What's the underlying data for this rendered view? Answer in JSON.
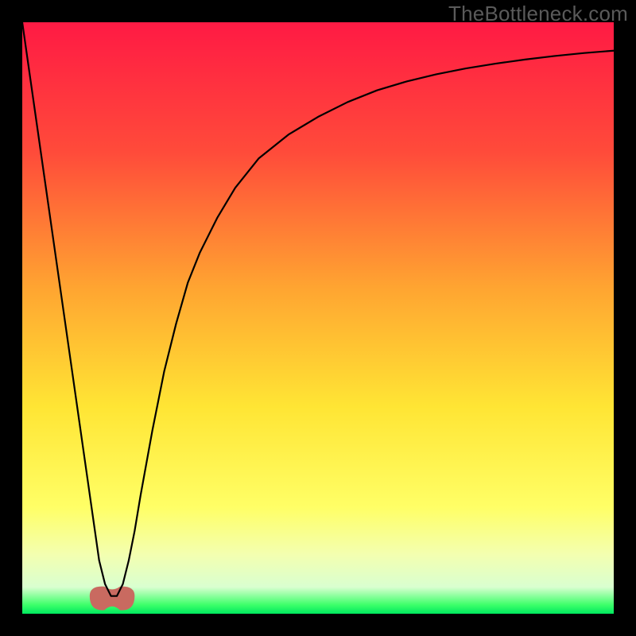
{
  "watermark": "TheBottleneck.com",
  "chart_data": {
    "type": "line",
    "title": "",
    "xlabel": "",
    "ylabel": "",
    "xlim": [
      0,
      100
    ],
    "ylim": [
      0,
      100
    ],
    "grid": false,
    "background_gradient": {
      "stops": [
        {
          "offset": 0.0,
          "color": "#ff1a44"
        },
        {
          "offset": 0.22,
          "color": "#ff4b3a"
        },
        {
          "offset": 0.45,
          "color": "#ffa531"
        },
        {
          "offset": 0.65,
          "color": "#ffe534"
        },
        {
          "offset": 0.82,
          "color": "#ffff66"
        },
        {
          "offset": 0.9,
          "color": "#f3ffb0"
        },
        {
          "offset": 0.955,
          "color": "#d9ffd0"
        },
        {
          "offset": 0.985,
          "color": "#3dff6a"
        },
        {
          "offset": 1.0,
          "color": "#00e85f"
        }
      ]
    },
    "series": [
      {
        "name": "bottleneck-v-curve",
        "color": "#000000",
        "width": 2.2,
        "x": [
          0,
          2,
          4,
          6,
          8,
          10,
          11,
          12,
          13,
          14,
          15,
          16,
          17,
          18,
          19,
          20,
          22,
          24,
          26,
          28,
          30,
          33,
          36,
          40,
          45,
          50,
          55,
          60,
          65,
          70,
          75,
          80,
          85,
          90,
          95,
          100
        ],
        "y": [
          100,
          86,
          72,
          58,
          44,
          30,
          23,
          16,
          9,
          5,
          3,
          3,
          5,
          9,
          14,
          20,
          31,
          41,
          49,
          56,
          61,
          67,
          72,
          77,
          81,
          84,
          86.5,
          88.5,
          90,
          91.2,
          92.2,
          93,
          93.7,
          94.3,
          94.8,
          95.2
        ]
      }
    ],
    "marker": {
      "name": "optimal-point-marker",
      "shape": "blob",
      "color": "#c96a60",
      "cx": 15.2,
      "cy": 3.0,
      "rx": 3.8,
      "ry": 1.6
    }
  }
}
